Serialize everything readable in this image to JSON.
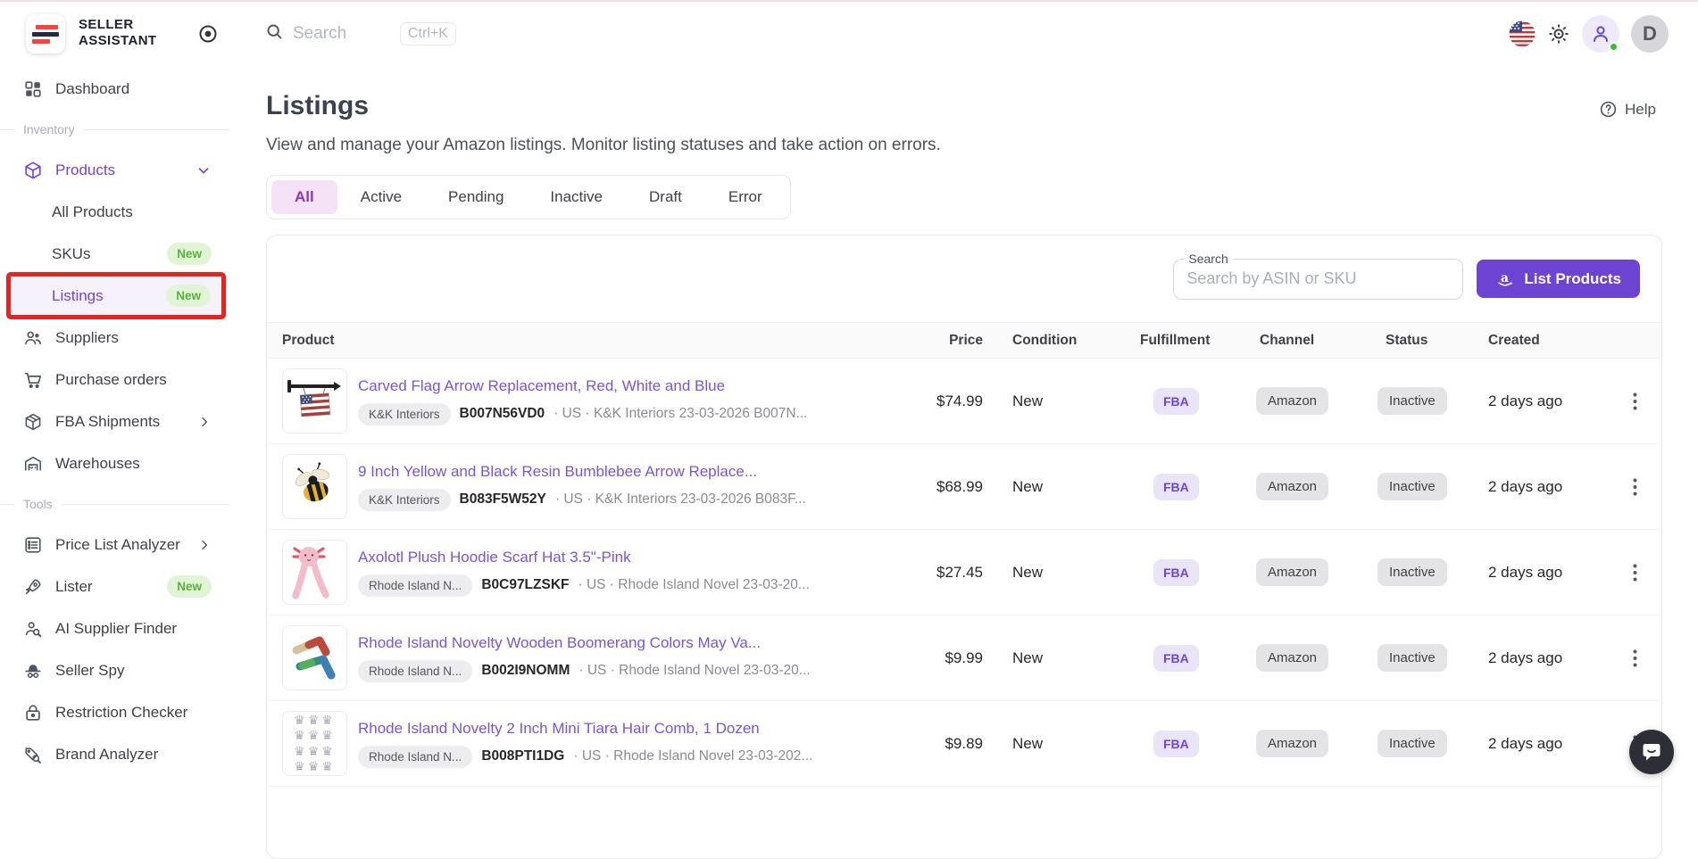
{
  "brand": {
    "line1": "SELLER",
    "line2": "ASSISTANT"
  },
  "topbar": {
    "search_placeholder": "Search",
    "shortcut": "Ctrl+K",
    "avatar_letter": "D"
  },
  "header": {
    "title": "Listings",
    "subtitle": "View and manage your Amazon listings. Monitor listing statuses and take action on errors.",
    "help": "Help"
  },
  "sidebar": {
    "dashboard": "Dashboard",
    "section_inventory": "Inventory",
    "products": "Products",
    "all_products": "All Products",
    "skus": "SKUs",
    "listings": "Listings",
    "suppliers": "Suppliers",
    "purchase_orders": "Purchase orders",
    "fba_shipments": "FBA Shipments",
    "warehouses": "Warehouses",
    "section_tools": "Tools",
    "price_list_analyzer": "Price List Analyzer",
    "lister": "Lister",
    "ai_supplier_finder": "AI Supplier Finder",
    "seller_spy": "Seller Spy",
    "restriction_checker": "Restriction Checker",
    "brand_analyzer": "Brand Analyzer",
    "new_badge": "New"
  },
  "tabs": {
    "all": "All",
    "active": "Active",
    "pending": "Pending",
    "inactive": "Inactive",
    "draft": "Draft",
    "error": "Error"
  },
  "toolbar": {
    "search_label": "Search",
    "search_placeholder": "Search by ASIN or SKU",
    "list_products": "List Products"
  },
  "table": {
    "headers": {
      "product": "Product",
      "price": "Price",
      "condition": "Condition",
      "fulfillment": "Fulfillment",
      "channel": "Channel",
      "status": "Status",
      "created": "Created"
    },
    "rows": [
      {
        "title": "Carved Flag Arrow Replacement, Red, White and Blue",
        "brand": "K&K Interiors",
        "asin": "B007N56VD0",
        "meta": "· US · K&K Interiors 23-03-2026 B007N...",
        "price": "$74.99",
        "condition": "New",
        "fulfillment": "FBA",
        "channel": "Amazon",
        "status": "Inactive",
        "created": "2 days ago"
      },
      {
        "title": "9 Inch Yellow and Black Resin Bumblebee Arrow Replace...",
        "brand": "K&K Interiors",
        "asin": "B083F5W52Y",
        "meta": "· US · K&K Interiors 23-03-2026 B083F...",
        "price": "$68.99",
        "condition": "New",
        "fulfillment": "FBA",
        "channel": "Amazon",
        "status": "Inactive",
        "created": "2 days ago"
      },
      {
        "title": "Axolotl Plush Hoodie Scarf Hat 3.5\"-Pink",
        "brand": "Rhode Island N...",
        "asin": "B0C97LZSKF",
        "meta": "· US · Rhode Island Novel 23-03-20...",
        "price": "$27.45",
        "condition": "New",
        "fulfillment": "FBA",
        "channel": "Amazon",
        "status": "Inactive",
        "created": "2 days ago"
      },
      {
        "title": "Rhode Island Novelty Wooden Boomerang Colors May Va...",
        "brand": "Rhode Island N...",
        "asin": "B002I9NOMM",
        "meta": "· US · Rhode Island Novel 23-03-20...",
        "price": "$9.99",
        "condition": "New",
        "fulfillment": "FBA",
        "channel": "Amazon",
        "status": "Inactive",
        "created": "2 days ago"
      },
      {
        "title": "Rhode Island Novelty 2 Inch Mini Tiara Hair Comb, 1 Dozen",
        "brand": "Rhode Island N...",
        "asin": "B008PTI1DG",
        "meta": "· US · Rhode Island Novel 23-03-202...",
        "price": "$9.89",
        "condition": "New",
        "fulfillment": "FBA",
        "channel": "Amazon",
        "status": "Inactive",
        "created": "2 days ago"
      }
    ]
  },
  "colors": {
    "accent": "#6d43d1",
    "link": "#7c52d9",
    "fba_bg": "#eae4f9",
    "fba_text": "#6d45d6",
    "chip_bg": "#e4e4e7",
    "new_badge_bg": "#e1f5d6",
    "new_badge_text": "#56b33a",
    "annotation_red": "#e8231d",
    "logo_red": "#f4443e",
    "logo_navy": "#232a3d"
  }
}
